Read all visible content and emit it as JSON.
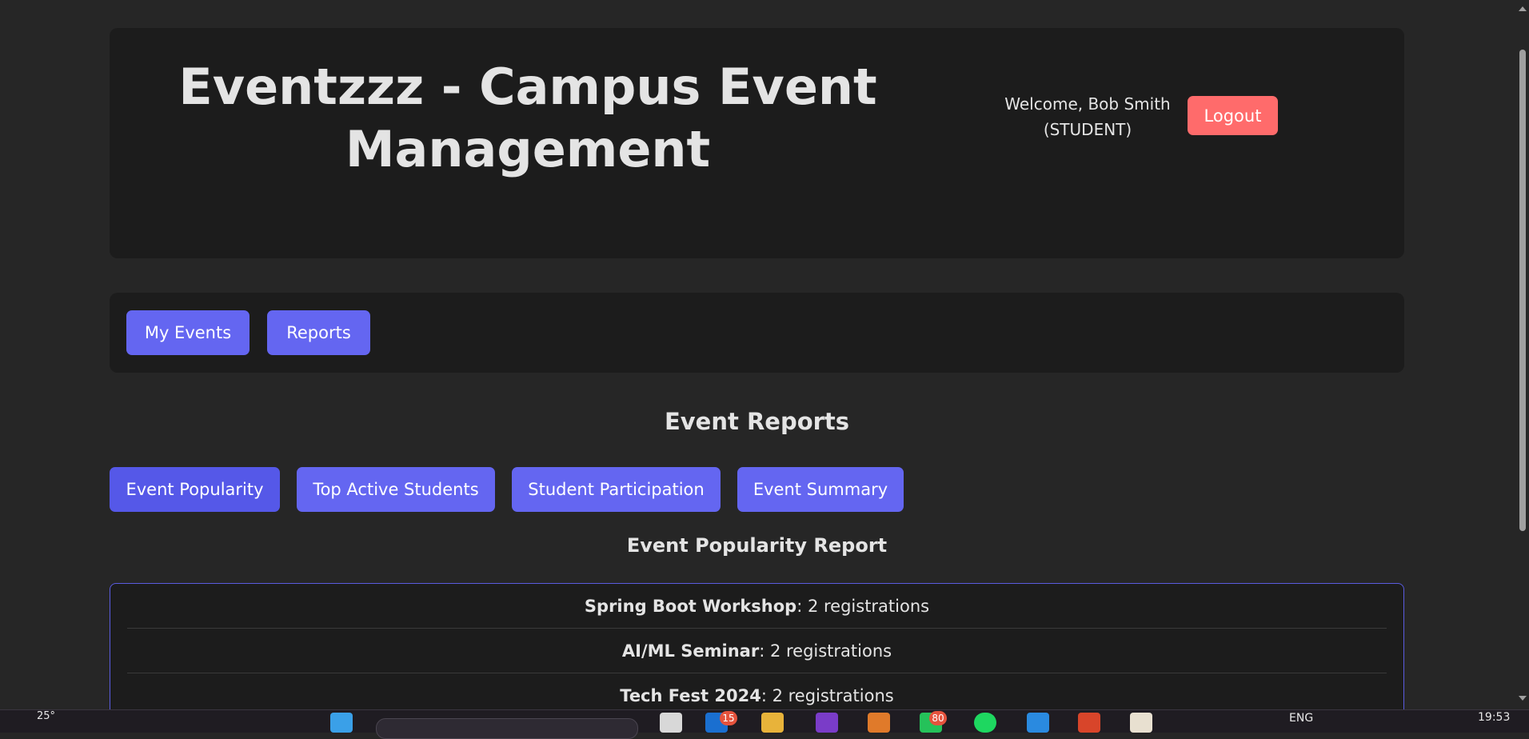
{
  "header": {
    "title": "Eventzzz - Campus Event Management",
    "welcome_line1": "Welcome, Bob Smith",
    "welcome_line2": "(STUDENT)",
    "logout_label": "Logout"
  },
  "nav": {
    "items": [
      {
        "label": "My Events"
      },
      {
        "label": "Reports"
      }
    ]
  },
  "reports": {
    "heading": "Event Reports",
    "tabs": [
      {
        "label": "Event Popularity",
        "active": true
      },
      {
        "label": "Top Active Students"
      },
      {
        "label": "Student Participation"
      },
      {
        "label": "Event Summary"
      }
    ],
    "current_report_title": "Event Popularity Report",
    "rows": [
      {
        "event": "Spring Boot Workshop",
        "detail": ": 2 registrations"
      },
      {
        "event": "AI/ML Seminar",
        "detail": ": 2 registrations"
      },
      {
        "event": "Tech Fest 2024",
        "detail": ": 2 registrations"
      }
    ]
  },
  "taskbar": {
    "weather": "25°",
    "outlook_badge": "15",
    "whatsapp_badge": "80",
    "language": "ENG",
    "time": "19:53"
  },
  "colors": {
    "background": "#262626",
    "panel": "#1c1c1c",
    "accent": "#6466f1",
    "logout": "#ff6b6b"
  }
}
